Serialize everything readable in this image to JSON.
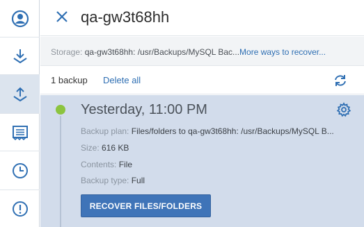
{
  "rail": {
    "items": [
      {
        "name": "account",
        "icon": "user-circle-icon"
      },
      {
        "name": "backup",
        "icon": "download-icon"
      },
      {
        "name": "recovery",
        "icon": "upload-icon",
        "active": true
      },
      {
        "name": "activities",
        "icon": "list-icon"
      },
      {
        "name": "schedule",
        "icon": "clock-icon"
      },
      {
        "name": "alerts",
        "icon": "exclamation-icon"
      }
    ]
  },
  "header": {
    "title": "qa-gw3t68hh",
    "close_icon": "close-icon"
  },
  "storage": {
    "label": "Storage:",
    "value": "qa-gw3t68hh: /usr/Backups/MySQL Bac...",
    "more_link": "More ways to recover..."
  },
  "list_header": {
    "count": "1 backup",
    "delete_all": "Delete all",
    "refresh_icon": "refresh-icon"
  },
  "backup": {
    "time": "Yesterday, 11:00 PM",
    "status_color": "#8cc43f",
    "settings_icon": "gear-icon",
    "plan_label": "Backup plan:",
    "plan_value": "Files/folders to qa-gw3t68hh: /usr/Backups/MySQL B...",
    "size_label": "Size:",
    "size_value": "616 KB",
    "contents_label": "Contents:",
    "contents_value": "File",
    "type_label": "Backup type:",
    "type_value": "Full",
    "recover_button": "RECOVER FILES/FOLDERS"
  },
  "colors": {
    "accent": "#3f74b8",
    "link": "#2f6fb3",
    "selected_background": "#d2dceb"
  }
}
